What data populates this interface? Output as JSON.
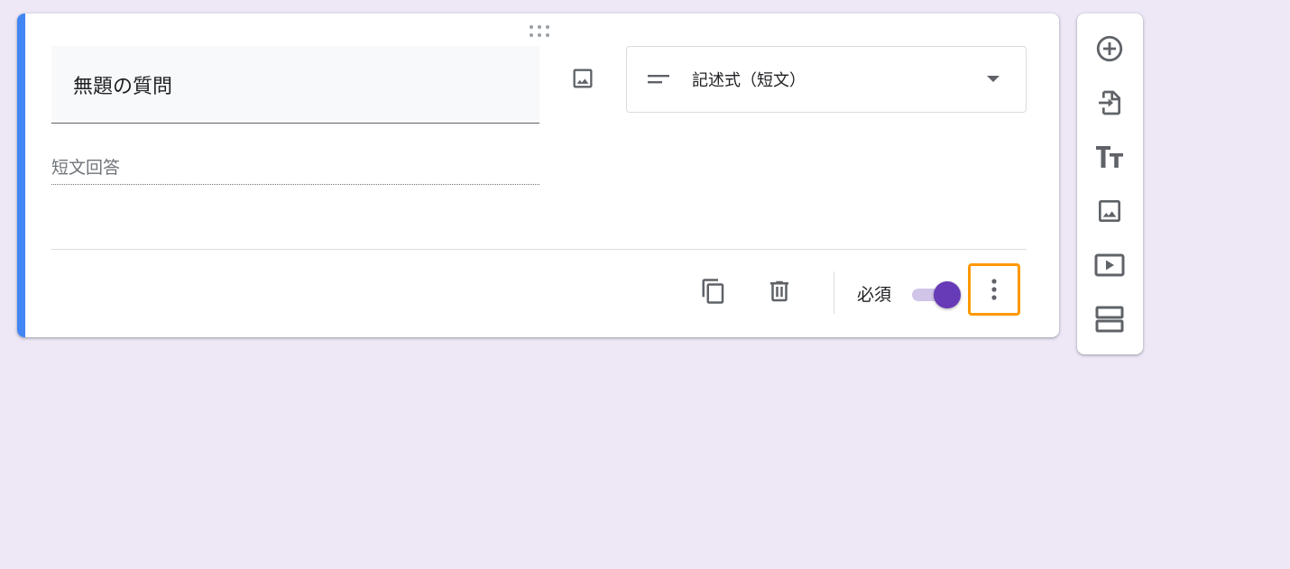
{
  "question": {
    "title": "無題の質問",
    "answer_placeholder": "短文回答",
    "type_label": "記述式（短文）",
    "required_label": "必須",
    "required_on": true
  },
  "colors": {
    "accent": "#4285f4",
    "toggle": "#673ab7",
    "highlight": "#ff9800",
    "background": "#ede7f6"
  },
  "icons": {
    "drag": "drag-handle-icon",
    "image": "image-icon",
    "short_answer": "short-text-icon",
    "dropdown": "arrow-drop-down-icon",
    "copy": "copy-icon",
    "delete": "trash-icon",
    "more": "more-vert-icon"
  },
  "toolbar": {
    "items": [
      {
        "icon": "add-circle-icon"
      },
      {
        "icon": "import-icon"
      },
      {
        "icon": "title-icon"
      },
      {
        "icon": "image-icon"
      },
      {
        "icon": "video-icon"
      },
      {
        "icon": "section-icon"
      }
    ]
  }
}
